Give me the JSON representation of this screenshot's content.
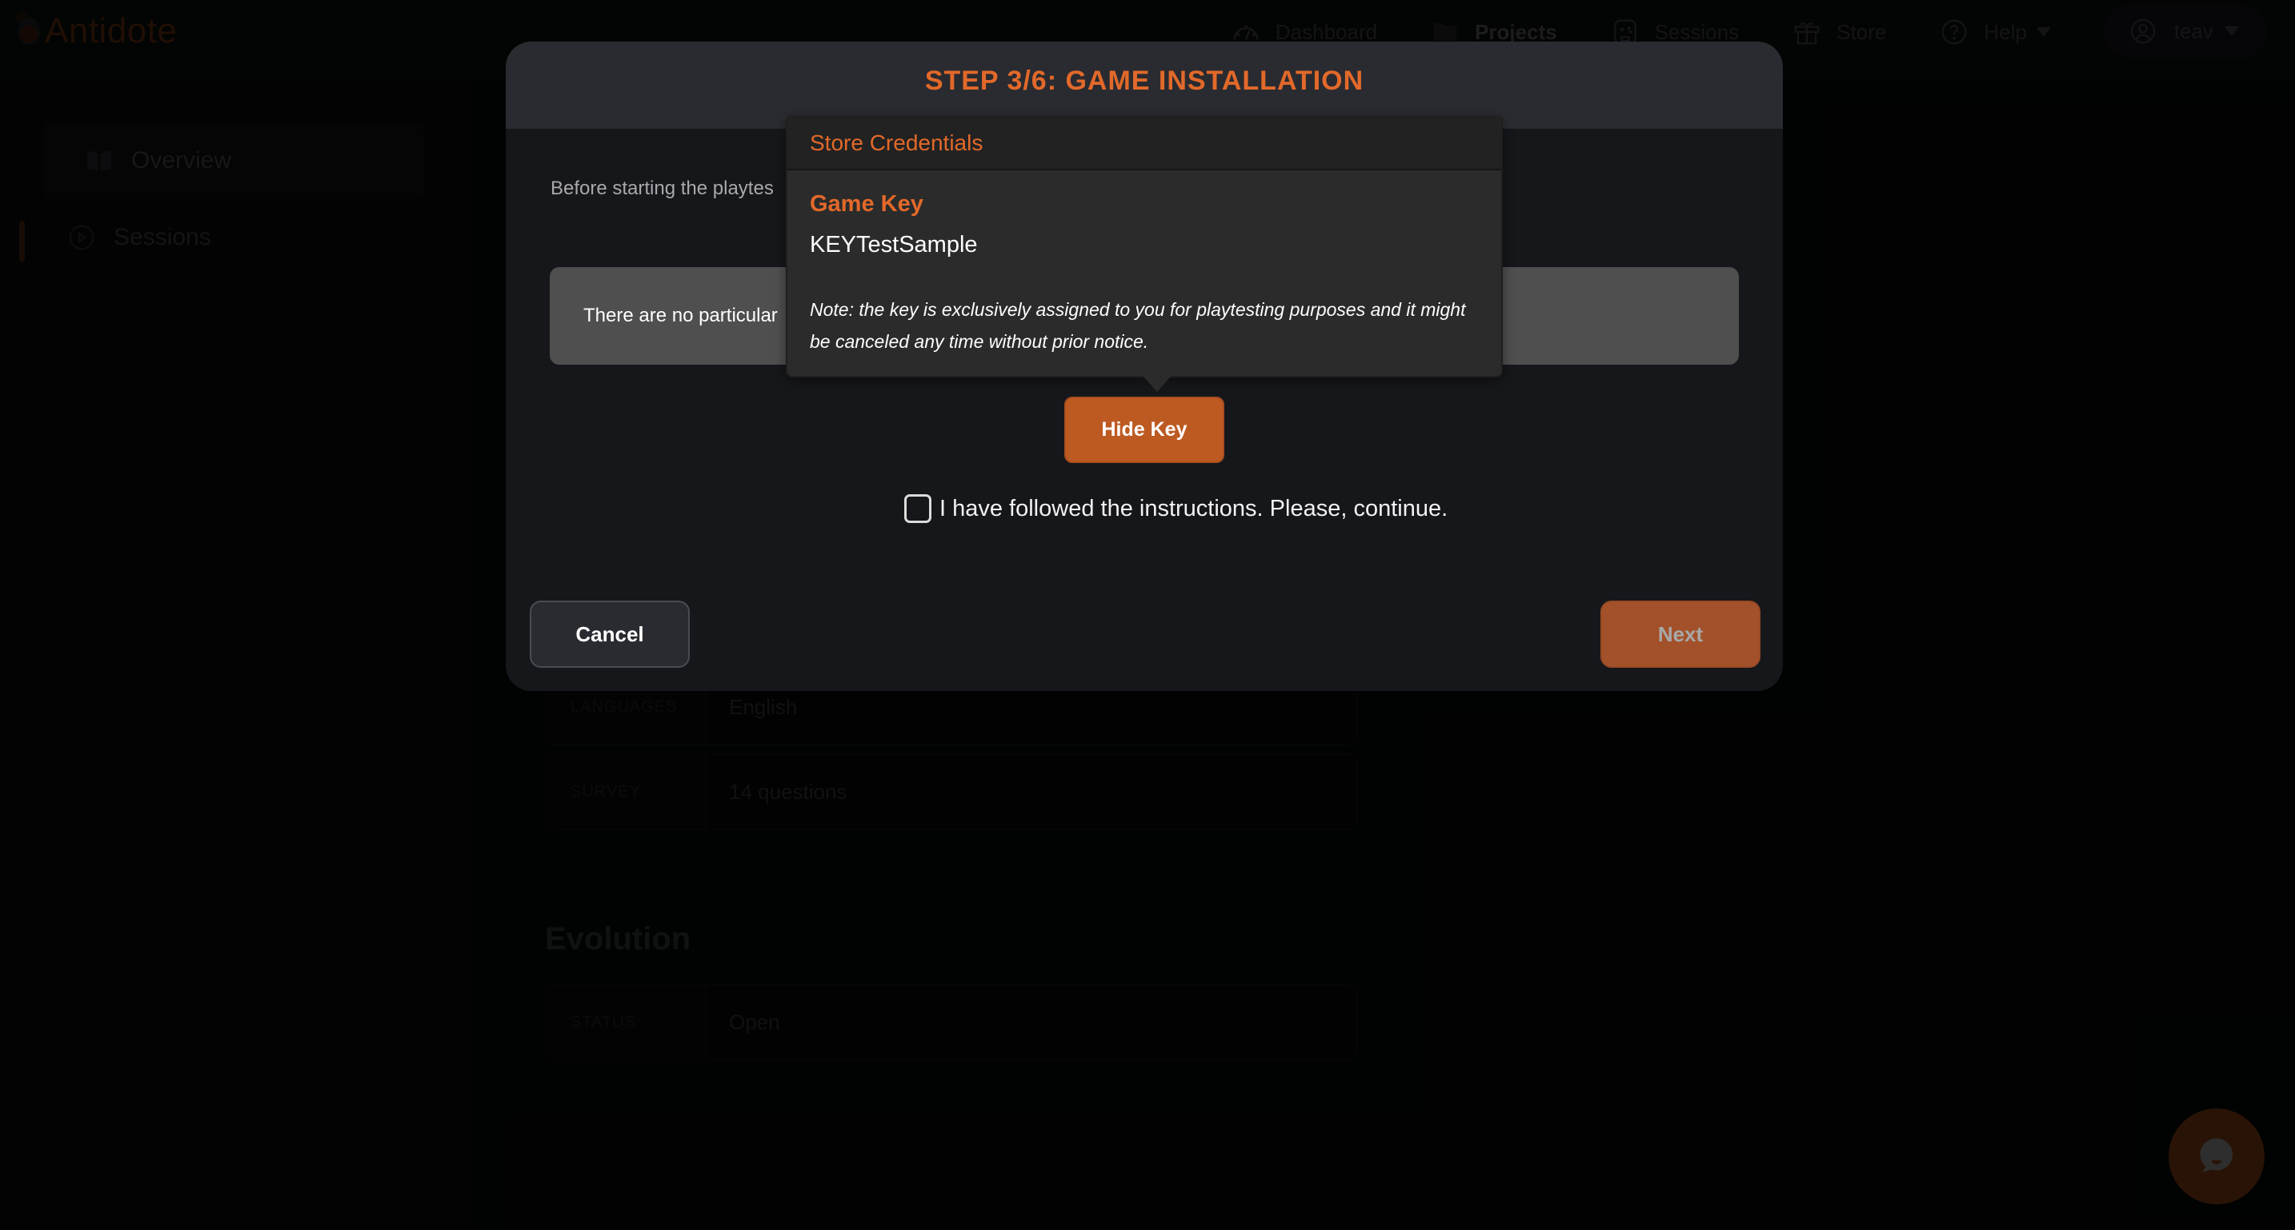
{
  "app": {
    "logo_text": "Antidote",
    "nav": [
      {
        "label": "Dashboard",
        "icon": "gauge-icon",
        "active": false
      },
      {
        "label": "Projects",
        "icon": "folder-icon",
        "active": true
      },
      {
        "label": "Sessions",
        "icon": "gamepad-icon",
        "active": false
      },
      {
        "label": "Store",
        "icon": "gift-icon",
        "active": false
      },
      {
        "label": "Help",
        "icon": "question-icon",
        "active": false,
        "dropdown": true
      }
    ],
    "user": {
      "name": "teav",
      "icon": "user-icon",
      "dropdown": true
    }
  },
  "sidebar": {
    "items": [
      {
        "label": "Overview",
        "icon": "book-icon",
        "active": true
      },
      {
        "label": "Sessions",
        "icon": "play-circle-icon",
        "active": false
      }
    ]
  },
  "main": {
    "details": [
      {
        "label": "LANGUAGES",
        "value": "English"
      },
      {
        "label": "SURVEY",
        "value": "14 questions"
      }
    ],
    "evolution": {
      "title": "Evolution",
      "rows": [
        {
          "label": "STATUS",
          "value": "Open"
        }
      ]
    }
  },
  "modal": {
    "title": "STEP 3/6: GAME INSTALLATION",
    "intro_text": "Before starting the playtes",
    "notice_text": "There are no particular",
    "hide_key_label": "Hide Key",
    "confirm_label": "I have followed the instructions. Please, continue.",
    "confirm_checked": false,
    "cancel_label": "Cancel",
    "next_label": "Next",
    "next_enabled": false
  },
  "popover": {
    "title": "Store Credentials",
    "key_label": "Game Key",
    "key_value": "KEYTestSample",
    "note": "Note: the key is exclusively assigned to you for playtesting purposes and it might be canceled any time without prior notice."
  },
  "colors": {
    "accent": "#e2692a",
    "button_primary": "#bd5a22",
    "modal_header": "#2a2b30",
    "modal_body": "#16171b",
    "notice_box": "#4f4f4f",
    "popover_bg": "#2b2b2b"
  }
}
